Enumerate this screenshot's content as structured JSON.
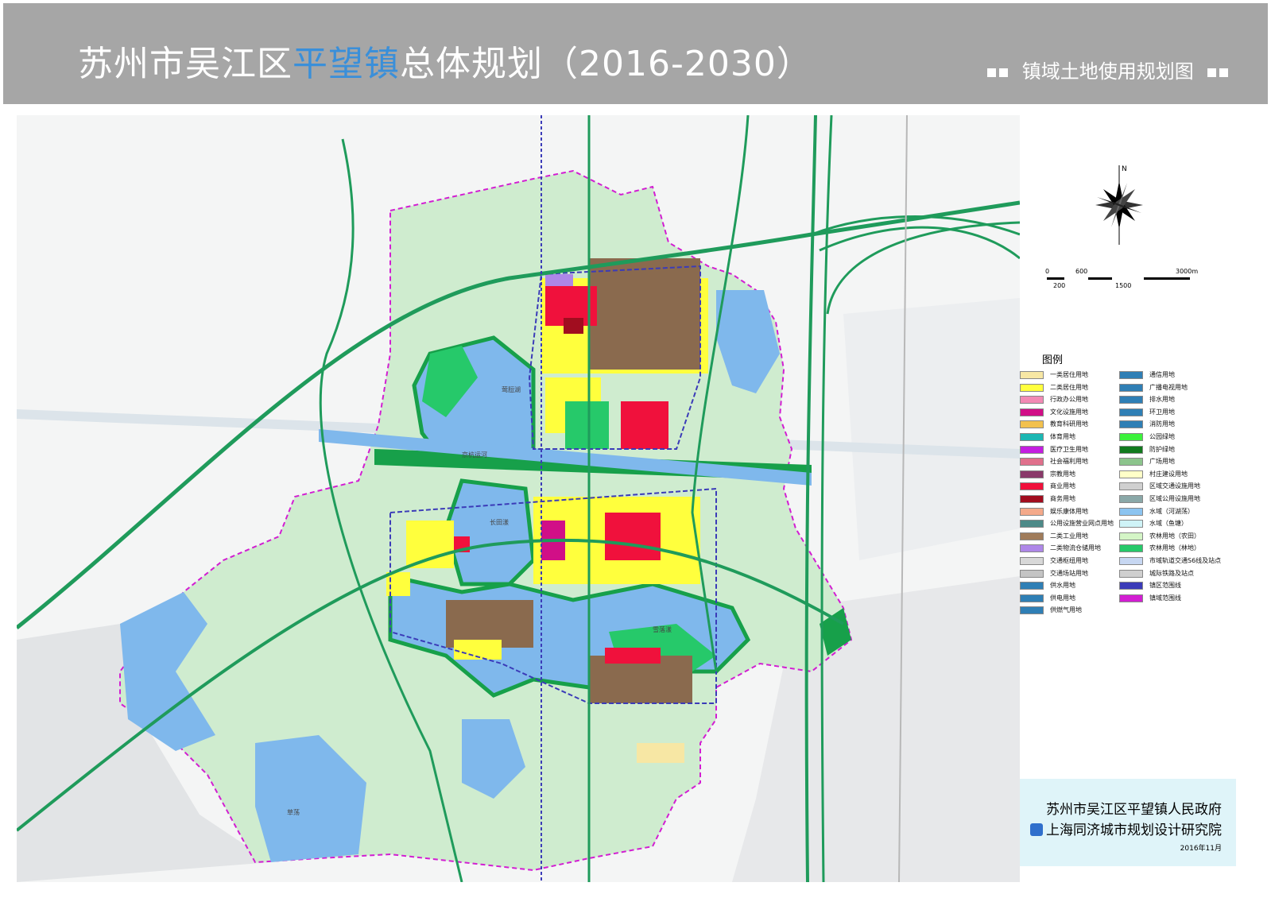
{
  "header": {
    "title_pre": "苏州市吴江区",
    "title_highlight": "平望镇",
    "title_post": "总体规划（2016-2030）",
    "subtitle": "镇域土地使用规划图"
  },
  "compass": {
    "north_label": "N"
  },
  "scale_bar": {
    "labels_top": [
      "0",
      "600",
      "3000m"
    ],
    "labels_bottom": [
      "200",
      "1500"
    ]
  },
  "legend": {
    "title": "图例",
    "left": [
      {
        "label": "一类居住用地",
        "color": "#f7e7a4"
      },
      {
        "label": "二类居住用地",
        "color": "#ffff3d"
      },
      {
        "label": "行政办公用地",
        "color": "#f28ab4"
      },
      {
        "label": "文化设施用地",
        "color": "#d10f87"
      },
      {
        "label": "教育科研用地",
        "color": "#f2c14e"
      },
      {
        "label": "体育用地",
        "color": "#1cb7b3"
      },
      {
        "label": "医疗卫生用地",
        "color": "#c41ee0"
      },
      {
        "label": "社会福利用地",
        "color": "#e0708c"
      },
      {
        "label": "宗教用地",
        "color": "#8a3a6a"
      },
      {
        "label": "商业用地",
        "color": "#f0113c"
      },
      {
        "label": "商务用地",
        "color": "#a10d1f"
      },
      {
        "label": "娱乐康体用地",
        "color": "#f4a98a"
      },
      {
        "label": "公用设施营业网点用地",
        "color": "#4d8a88"
      },
      {
        "label": "二类工业用地",
        "color": "#a07c5b"
      },
      {
        "label": "二类物流仓储用地",
        "color": "#ae87e8"
      },
      {
        "label": "交通枢纽用地",
        "color": "#d8d8d8"
      },
      {
        "label": "交通场站用地",
        "color": "#c4c4c4"
      },
      {
        "label": "供水用地",
        "color": "#2f7fb5"
      },
      {
        "label": "供电用地",
        "color": "#2f7fb5"
      },
      {
        "label": "供燃气用地",
        "color": "#2f7fb5"
      }
    ],
    "right": [
      {
        "label": "通信用地",
        "color": "#2f7fb5"
      },
      {
        "label": "广播电视用地",
        "color": "#2f7fb5"
      },
      {
        "label": "排水用地",
        "color": "#2f7fb5"
      },
      {
        "label": "环卫用地",
        "color": "#2f7fb5"
      },
      {
        "label": "消防用地",
        "color": "#2f7fb5"
      },
      {
        "label": "公园绿地",
        "color": "#3cf23c"
      },
      {
        "label": "防护绿地",
        "color": "#127a1e"
      },
      {
        "label": "广场用地",
        "color": "#8cc48c"
      },
      {
        "label": "村庄建设用地",
        "color": "#ffffc8"
      },
      {
        "label": "区域交通设施用地",
        "color": "#d0d0d0"
      },
      {
        "label": "区域公用设施用地",
        "color": "#8aa8a8"
      },
      {
        "label": "水域（河湖荡）",
        "color": "#8cc4f0"
      },
      {
        "label": "水域（鱼塘）",
        "color": "#cff3f7"
      },
      {
        "label": "农林用地（农田）",
        "color": "#d4f5c6"
      },
      {
        "label": "农林用地（林地）",
        "color": "#26c96a"
      },
      {
        "label": "市域轨道交通S6线及站点",
        "color": "#c7d7f2"
      },
      {
        "label": "城际铁路及站点",
        "color": "#cfcfcf"
      },
      {
        "label": "镇区范围线",
        "color": "#3b3bb8"
      },
      {
        "label": "镇域范围线",
        "color": "#d21ed2"
      }
    ]
  },
  "credits": {
    "line1": "苏州市吴江区平望镇人民政府",
    "line2": "上海同济城市规划设计研究院",
    "date": "2016年11月"
  },
  "map_labels": {
    "lake_n": "莺脰湖",
    "lake_s": "雪落漾",
    "lake_c": "长田漾",
    "lake_sw": "草荡",
    "canal": "京杭运河"
  }
}
